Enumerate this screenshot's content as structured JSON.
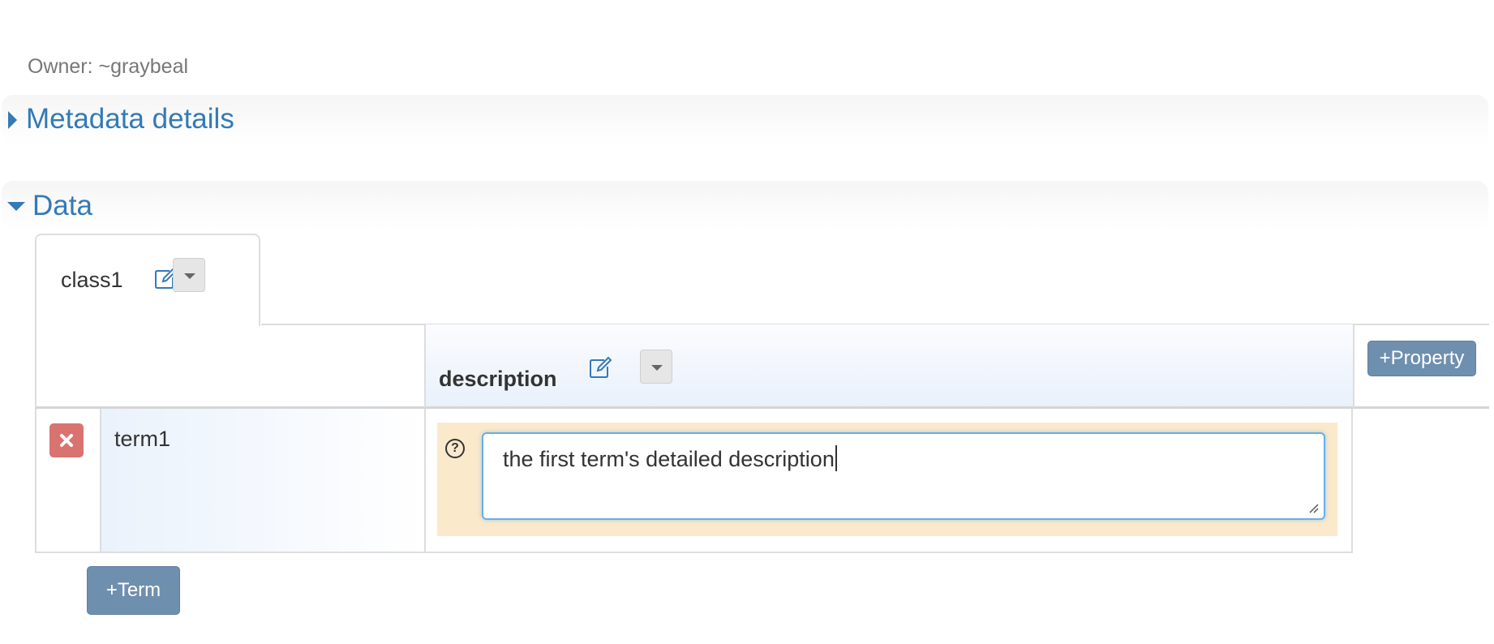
{
  "owner_text": "Owner: ~graybeal",
  "sections": {
    "metadata": {
      "title": "Metadata details",
      "expanded": false
    },
    "data": {
      "title": "Data",
      "expanded": true
    }
  },
  "tab": {
    "label": "class1",
    "edit_icon": "edit-icon",
    "menu_icon": "caret-down-icon"
  },
  "table": {
    "property_column": {
      "title": "description",
      "edit_icon": "edit-icon",
      "menu_icon": "caret-down-icon"
    },
    "add_property_label": "+Property",
    "rows": [
      {
        "term": "term1",
        "delete_icon": "close-icon",
        "help_icon": "question-icon",
        "description_value": "the first term's detailed description"
      }
    ],
    "add_term_label": "+Term"
  },
  "colors": {
    "link_blue": "#337ab7",
    "action_button": "#6f8faf",
    "delete_button": "#d9736f",
    "value_highlight": "#fbe9cc",
    "focus_border": "#66afe9"
  }
}
